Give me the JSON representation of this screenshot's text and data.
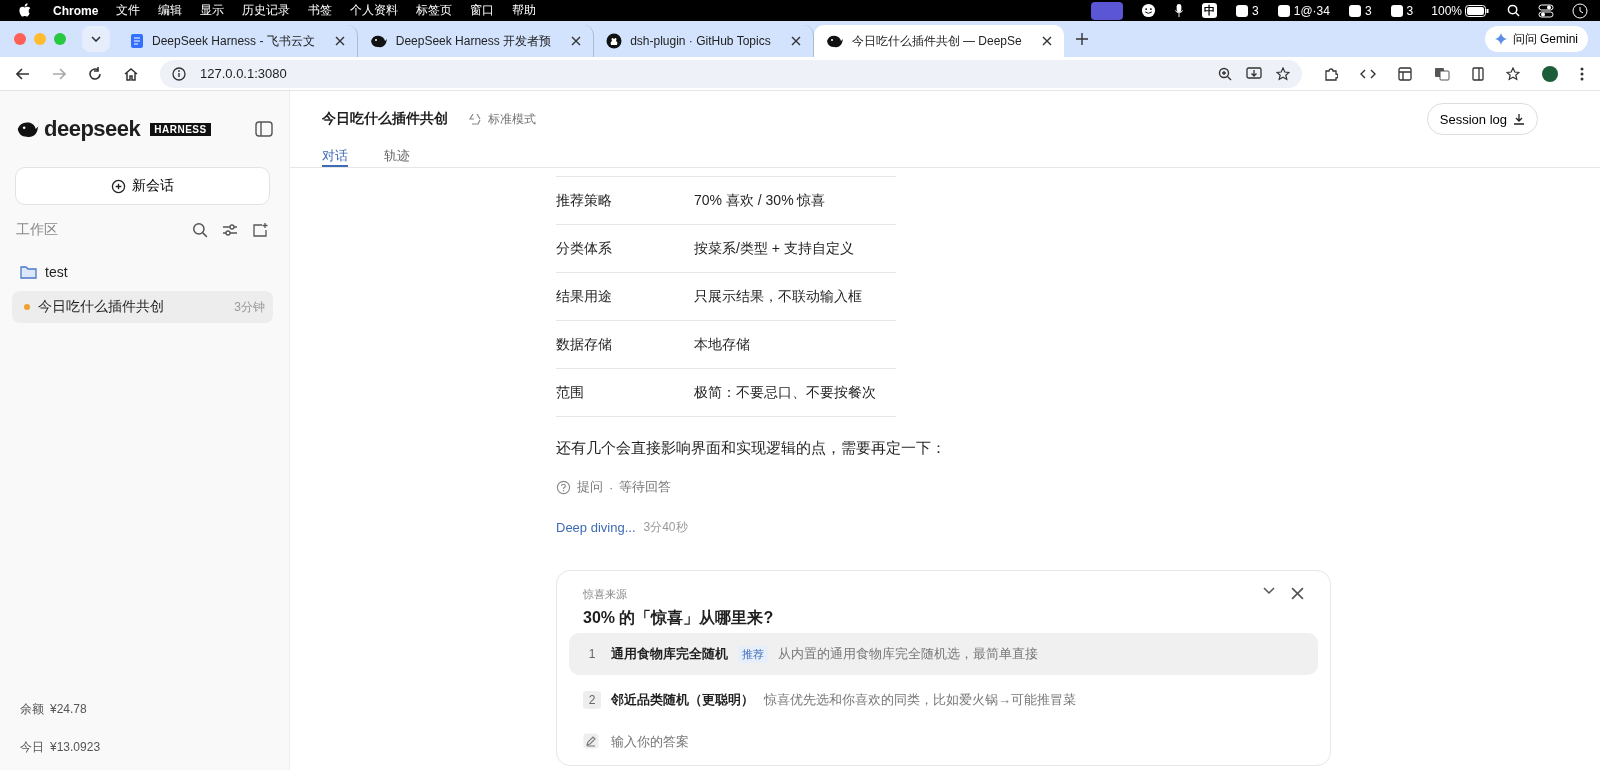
{
  "menubar": {
    "app": "Chrome",
    "menus": [
      "文件",
      "编辑",
      "显示",
      "历史记录",
      "书签",
      "个人资料",
      "标签页",
      "窗口",
      "帮助"
    ],
    "status": [
      {
        "kind": "glyph",
        "text": "中"
      },
      {
        "kind": "count",
        "text": "3"
      },
      {
        "kind": "count",
        "text": "1@·34"
      },
      {
        "kind": "count",
        "text": "3"
      },
      {
        "kind": "count",
        "text": "3"
      },
      {
        "kind": "battery",
        "text": "100%"
      }
    ]
  },
  "tabs": [
    {
      "kind": "doc",
      "title": "DeepSeek Harness - 飞书云文",
      "selected": false
    },
    {
      "kind": "whale",
      "title": "DeepSeek Harness 开发者预",
      "selected": false
    },
    {
      "kind": "github",
      "title": "dsh-plugin · GitHub Topics",
      "selected": false
    },
    {
      "kind": "whale",
      "title": "今日吃什么插件共创 — DeepSe",
      "selected": true
    }
  ],
  "gemini": "问问 Gemini",
  "address": "127.0.0.1:3080",
  "sidebar": {
    "brand": "deepseek",
    "badge": "HARNESS",
    "new_chat": "新会话",
    "section": "工作区",
    "tree": [
      {
        "name": "test",
        "children": [
          {
            "title": "今日吃什么插件共创",
            "time": "3分钟",
            "selected": true,
            "color": "#f0a030"
          }
        ]
      }
    ],
    "stats": [
      {
        "label": "余额",
        "value": "¥24.78"
      },
      {
        "label": "今日",
        "value": "¥13.0923"
      }
    ]
  },
  "header": {
    "title": "今日吃什么插件共创",
    "mode": "标准模式",
    "session_log": "Session log",
    "tabs": [
      {
        "label": "对话",
        "selected": true
      },
      {
        "label": "轨迹",
        "selected": false
      }
    ]
  },
  "table": {
    "rows": [
      {
        "key": "推荐策略",
        "value": "70% 喜欢 / 30% 惊喜"
      },
      {
        "key": "分类体系",
        "value": "按菜系/类型 + 支持自定义"
      },
      {
        "key": "结果用途",
        "value": "只展示结果，不联动输入框"
      },
      {
        "key": "数据存储",
        "value": "本地存储"
      },
      {
        "key": "范围",
        "value": "极简：不要忌口、不要按餐次"
      }
    ]
  },
  "message": "还有几个会直接影响界面和实现逻辑的点，需要再定一下：",
  "question_status": {
    "label": "提问",
    "separator": "·",
    "state": "等待回答"
  },
  "thinking": {
    "label": "Deep diving...",
    "time": "3分40秒"
  },
  "card": {
    "category": "惊喜来源",
    "question": "30% 的「惊喜」从哪里来?",
    "options": [
      {
        "number": "1",
        "title": "通用食物库完全随机",
        "badge": "推荐",
        "description": "从内置的通用食物库完全随机选，最简单直接",
        "selected": true
      },
      {
        "number": "2",
        "title": "邻近品类随机（更聪明）",
        "description": "惊喜优先选和你喜欢的同类，比如爱火锅→可能推冒菜",
        "selected": false
      }
    ],
    "placeholder": "输入你的答案"
  }
}
